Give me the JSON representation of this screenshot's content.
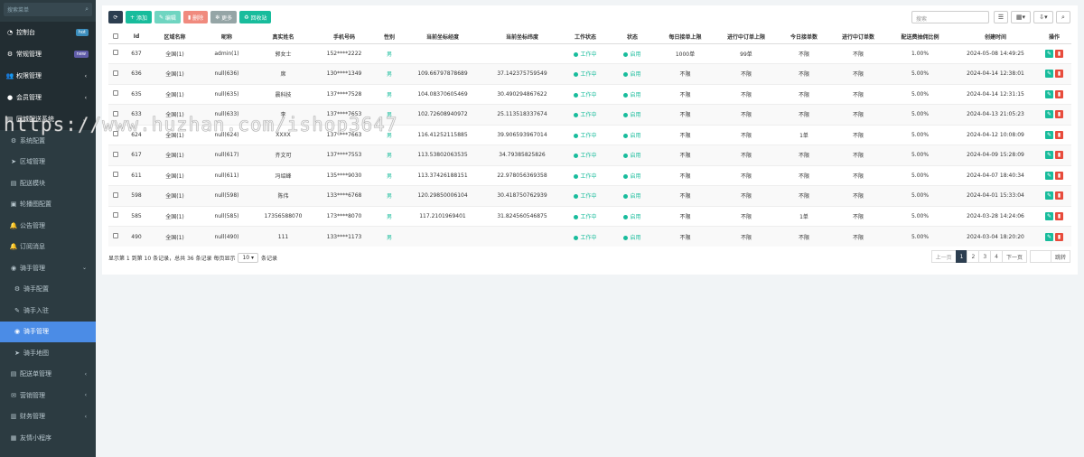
{
  "sidebar": {
    "search_placeholder": "搜索菜单",
    "items": [
      {
        "label": "控制台",
        "icon": "dashboard-icon",
        "badge": "hot",
        "badge_color": "#3c8dbc",
        "type": "top"
      },
      {
        "label": "常规管理",
        "icon": "gear-icon",
        "badge": "new",
        "badge_color": "#605ca8",
        "type": "top"
      },
      {
        "label": "权限管理",
        "icon": "group-icon",
        "chevron": "‹",
        "type": "top"
      },
      {
        "label": "会员管理",
        "icon": "user-icon",
        "chevron": "‹",
        "type": "top"
      },
      {
        "label": "同城配送系统",
        "icon": "list-icon",
        "chevron": "⌄",
        "type": "group"
      },
      {
        "label": "系统配置",
        "icon": "cog-icon",
        "type": "sub"
      },
      {
        "label": "区域管理",
        "icon": "location-icon",
        "type": "sub"
      },
      {
        "label": "配送模块",
        "icon": "list-icon",
        "type": "sub"
      },
      {
        "label": "轮播图配置",
        "icon": "image-icon",
        "type": "sub"
      },
      {
        "label": "公告管理",
        "icon": "bell-icon",
        "type": "sub"
      },
      {
        "label": "订阅消息",
        "icon": "bell-icon",
        "type": "sub"
      },
      {
        "label": "骑手管理",
        "icon": "user-circle-icon",
        "chevron": "⌄",
        "type": "subgroup"
      },
      {
        "label": "骑手配置",
        "icon": "cog-icon",
        "type": "sub2"
      },
      {
        "label": "骑手入驻",
        "icon": "edit-icon",
        "type": "sub2"
      },
      {
        "label": "骑手管理",
        "icon": "user-circle-icon",
        "type": "active"
      },
      {
        "label": "骑手地图",
        "icon": "location-icon",
        "type": "sub2"
      },
      {
        "label": "配送单管理",
        "icon": "list-icon",
        "chevron": "‹",
        "type": "sub"
      },
      {
        "label": "营销管理",
        "icon": "gift-icon",
        "chevron": "‹",
        "type": "sub"
      },
      {
        "label": "财务管理",
        "icon": "money-icon",
        "chevron": "‹",
        "type": "sub"
      },
      {
        "label": "友情小程序",
        "icon": "grid-icon",
        "type": "sub"
      }
    ]
  },
  "toolbar": {
    "add": "添加",
    "edit": "编辑",
    "delete": "删除",
    "more": "更多",
    "recycle": "回收站",
    "search_placeholder": "搜索"
  },
  "table": {
    "headers": [
      "",
      "Id",
      "区域名称",
      "昵称",
      "真实姓名",
      "手机号码",
      "性别",
      "当前坐标经度",
      "当前坐标纬度",
      "工作状态",
      "状态",
      "每日接单上限",
      "进行中订单上限",
      "今日接单数",
      "进行中订单数",
      "配送费抽佣比例",
      "创建时间",
      "操作"
    ],
    "rows": [
      {
        "id": "637",
        "area": "全国(1)",
        "nick": "admin(1)",
        "real": "郭女士",
        "phone": "152****2222",
        "sex": "男",
        "lng": "",
        "lat": "",
        "work": "工作中",
        "status": "启用",
        "daily_limit": "1000单",
        "ongoing_limit": "99单",
        "today": "不限",
        "ongoing": "不限",
        "ratio": "1.00%",
        "created": "2024-05-08 14:49:25"
      },
      {
        "id": "636",
        "area": "全国(1)",
        "nick": "null(636)",
        "real": "席",
        "phone": "130****1349",
        "sex": "男",
        "lng": "109.66797878689",
        "lat": "37.142375759549",
        "work": "工作中",
        "status": "启用",
        "daily_limit": "不限",
        "ongoing_limit": "不限",
        "today": "不限",
        "ongoing": "不限",
        "ratio": "5.00%",
        "created": "2024-04-14 12:38:01"
      },
      {
        "id": "635",
        "area": "全国(1)",
        "nick": "null(635)",
        "real": "晨科技",
        "phone": "137****7528",
        "sex": "男",
        "lng": "104.08370605469",
        "lat": "30.490294867622",
        "work": "工作中",
        "status": "启用",
        "daily_limit": "不限",
        "ongoing_limit": "不限",
        "today": "不限",
        "ongoing": "不限",
        "ratio": "5.00%",
        "created": "2024-04-14 12:31:15"
      },
      {
        "id": "633",
        "area": "全国(1)",
        "nick": "null(633)",
        "real": "李",
        "phone": "137****7653",
        "sex": "男",
        "lng": "102.72608940972",
        "lat": "25.113518337674",
        "work": "工作中",
        "status": "启用",
        "daily_limit": "不限",
        "ongoing_limit": "不限",
        "today": "不限",
        "ongoing": "不限",
        "ratio": "5.00%",
        "created": "2024-04-13 21:05:23"
      },
      {
        "id": "624",
        "area": "全国(1)",
        "nick": "null(624)",
        "real": "XXXX",
        "phone": "137****7663",
        "sex": "男",
        "lng": "116.41252115885",
        "lat": "39.906593967014",
        "work": "工作中",
        "status": "启用",
        "daily_limit": "不限",
        "ongoing_limit": "不限",
        "today": "1单",
        "ongoing": "不限",
        "ratio": "5.00%",
        "created": "2024-04-12 10:08:09"
      },
      {
        "id": "617",
        "area": "全国(1)",
        "nick": "null(617)",
        "real": "齐文可",
        "phone": "137****7553",
        "sex": "男",
        "lng": "113.53802063535",
        "lat": "34.79385825826",
        "work": "工作中",
        "status": "启用",
        "daily_limit": "不限",
        "ongoing_limit": "不限",
        "today": "不限",
        "ongoing": "不限",
        "ratio": "5.00%",
        "created": "2024-04-09 15:28:09"
      },
      {
        "id": "611",
        "area": "全国(1)",
        "nick": "null(611)",
        "real": "冯绍峰",
        "phone": "135****9030",
        "sex": "男",
        "lng": "113.37426188151",
        "lat": "22.978056369358",
        "work": "工作中",
        "status": "启用",
        "daily_limit": "不限",
        "ongoing_limit": "不限",
        "today": "不限",
        "ongoing": "不限",
        "ratio": "5.00%",
        "created": "2024-04-07 18:40:34"
      },
      {
        "id": "598",
        "area": "全国(1)",
        "nick": "null(598)",
        "real": "陈伟",
        "phone": "133****6768",
        "sex": "男",
        "lng": "120.29850006104",
        "lat": "30.418750762939",
        "work": "工作中",
        "status": "启用",
        "daily_limit": "不限",
        "ongoing_limit": "不限",
        "today": "不限",
        "ongoing": "不限",
        "ratio": "5.00%",
        "created": "2024-04-01 15:33:04"
      },
      {
        "id": "585",
        "area": "全国(1)",
        "nick": "null(585)",
        "real": "17356588070",
        "phone": "173****8070",
        "sex": "男",
        "lng": "117.2101969401",
        "lat": "31.824560546875",
        "work": "工作中",
        "status": "启用",
        "daily_limit": "不限",
        "ongoing_limit": "不限",
        "today": "1单",
        "ongoing": "不限",
        "ratio": "5.00%",
        "created": "2024-03-28 14:24:06"
      },
      {
        "id": "490",
        "area": "全国(1)",
        "nick": "null(490)",
        "real": "111",
        "phone": "133****1173",
        "sex": "男",
        "lng": "",
        "lat": "",
        "work": "工作中",
        "status": "启用",
        "daily_limit": "不限",
        "ongoing_limit": "不限",
        "today": "不限",
        "ongoing": "不限",
        "ratio": "5.00%",
        "created": "2024-03-04 18:20:20"
      }
    ]
  },
  "footer": {
    "info_prefix": "显示第 1 到第 10 条记录，总共 36 条记录 每页显示",
    "page_size": "10",
    "info_suffix": "条记录"
  },
  "pager": {
    "prev": "上一页",
    "pages": [
      "1",
      "2",
      "3",
      "4"
    ],
    "next": "下一页",
    "jump": "跳转"
  },
  "watermark": "https://www.huzhan.com/ishop3647",
  "colors": {
    "accent": "#18bc9c",
    "danger": "#e74c3c",
    "sidebar": "#2c3b41",
    "active": "#4b8ce6"
  }
}
